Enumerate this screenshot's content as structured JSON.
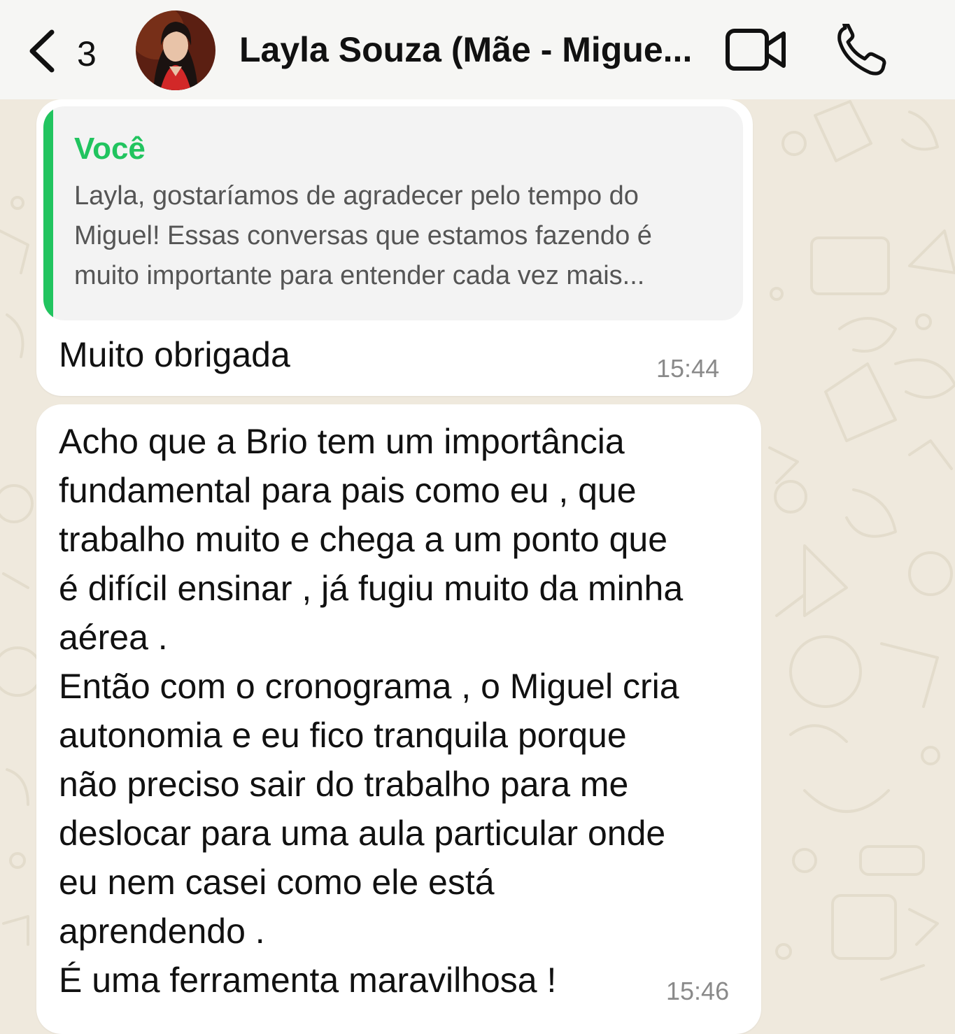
{
  "header": {
    "back_count": "3",
    "contact_name": "Layla Souza (Mãe - Migue...",
    "icons": {
      "back": "chevron-left-icon",
      "video": "video-camera-icon",
      "call": "phone-icon"
    }
  },
  "messages": [
    {
      "quoted": {
        "author": "Você",
        "author_color": "#21c45f",
        "lines": [
          "Layla, gostaríamos de agradecer pelo tempo do",
          "Miguel! Essas conversas que estamos fazendo é",
          "muito importante para entender cada vez mais..."
        ]
      },
      "text": "Muito obrigada",
      "time": "15:44"
    },
    {
      "lines": [
        "Acho que a Brio tem um importância",
        "fundamental para pais como eu , que",
        "trabalho muito e chega a um ponto que",
        "é difícil ensinar , já fugiu muito da minha",
        "aérea .",
        "Então com o cronograma , o Miguel cria",
        "autonomia e eu fico tranquila porque",
        "não preciso sair do trabalho para me",
        "deslocar para uma aula particular onde",
        "eu nem casei como ele está",
        "aprendendo .",
        "É uma ferramenta maravilhosa !"
      ],
      "time": "15:46"
    }
  ],
  "colors": {
    "wallpaper": "#efe9dd",
    "bubble": "#ffffff",
    "accent": "#21c45f"
  }
}
